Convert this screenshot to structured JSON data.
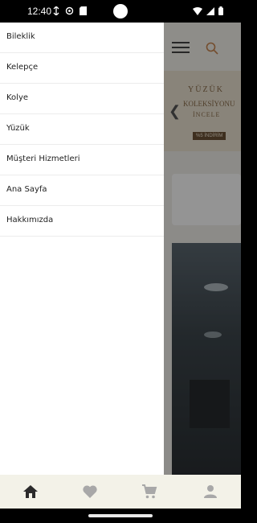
{
  "status_bar": {
    "time": "12:40"
  },
  "background_app": {
    "banner": {
      "line1": "YÜZÜK",
      "line2": "KOLEKSİYONU",
      "line3": "İNCELE",
      "badge": "%5 İNDİRİM"
    }
  },
  "drawer": {
    "items": [
      {
        "label": "Bileklik"
      },
      {
        "label": "Kelepçe"
      },
      {
        "label": "Kolye"
      },
      {
        "label": "Yüzük"
      },
      {
        "label": "Müşteri Hizmetleri"
      },
      {
        "label": "Ana Sayfa"
      },
      {
        "label": "Hakkımızda"
      }
    ]
  },
  "bottom_nav": {
    "items": [
      {
        "icon": "home-icon",
        "active": true
      },
      {
        "icon": "heart-icon",
        "active": false
      },
      {
        "icon": "cart-icon",
        "active": false
      },
      {
        "icon": "profile-icon",
        "active": false
      }
    ]
  },
  "colors": {
    "nav_active": "#2b2b2b",
    "nav_inactive": "#a8a8a8",
    "nav_background": "#f3f2e8",
    "banner_text": "#8a6d4a",
    "search_accent": "#c9864f"
  }
}
